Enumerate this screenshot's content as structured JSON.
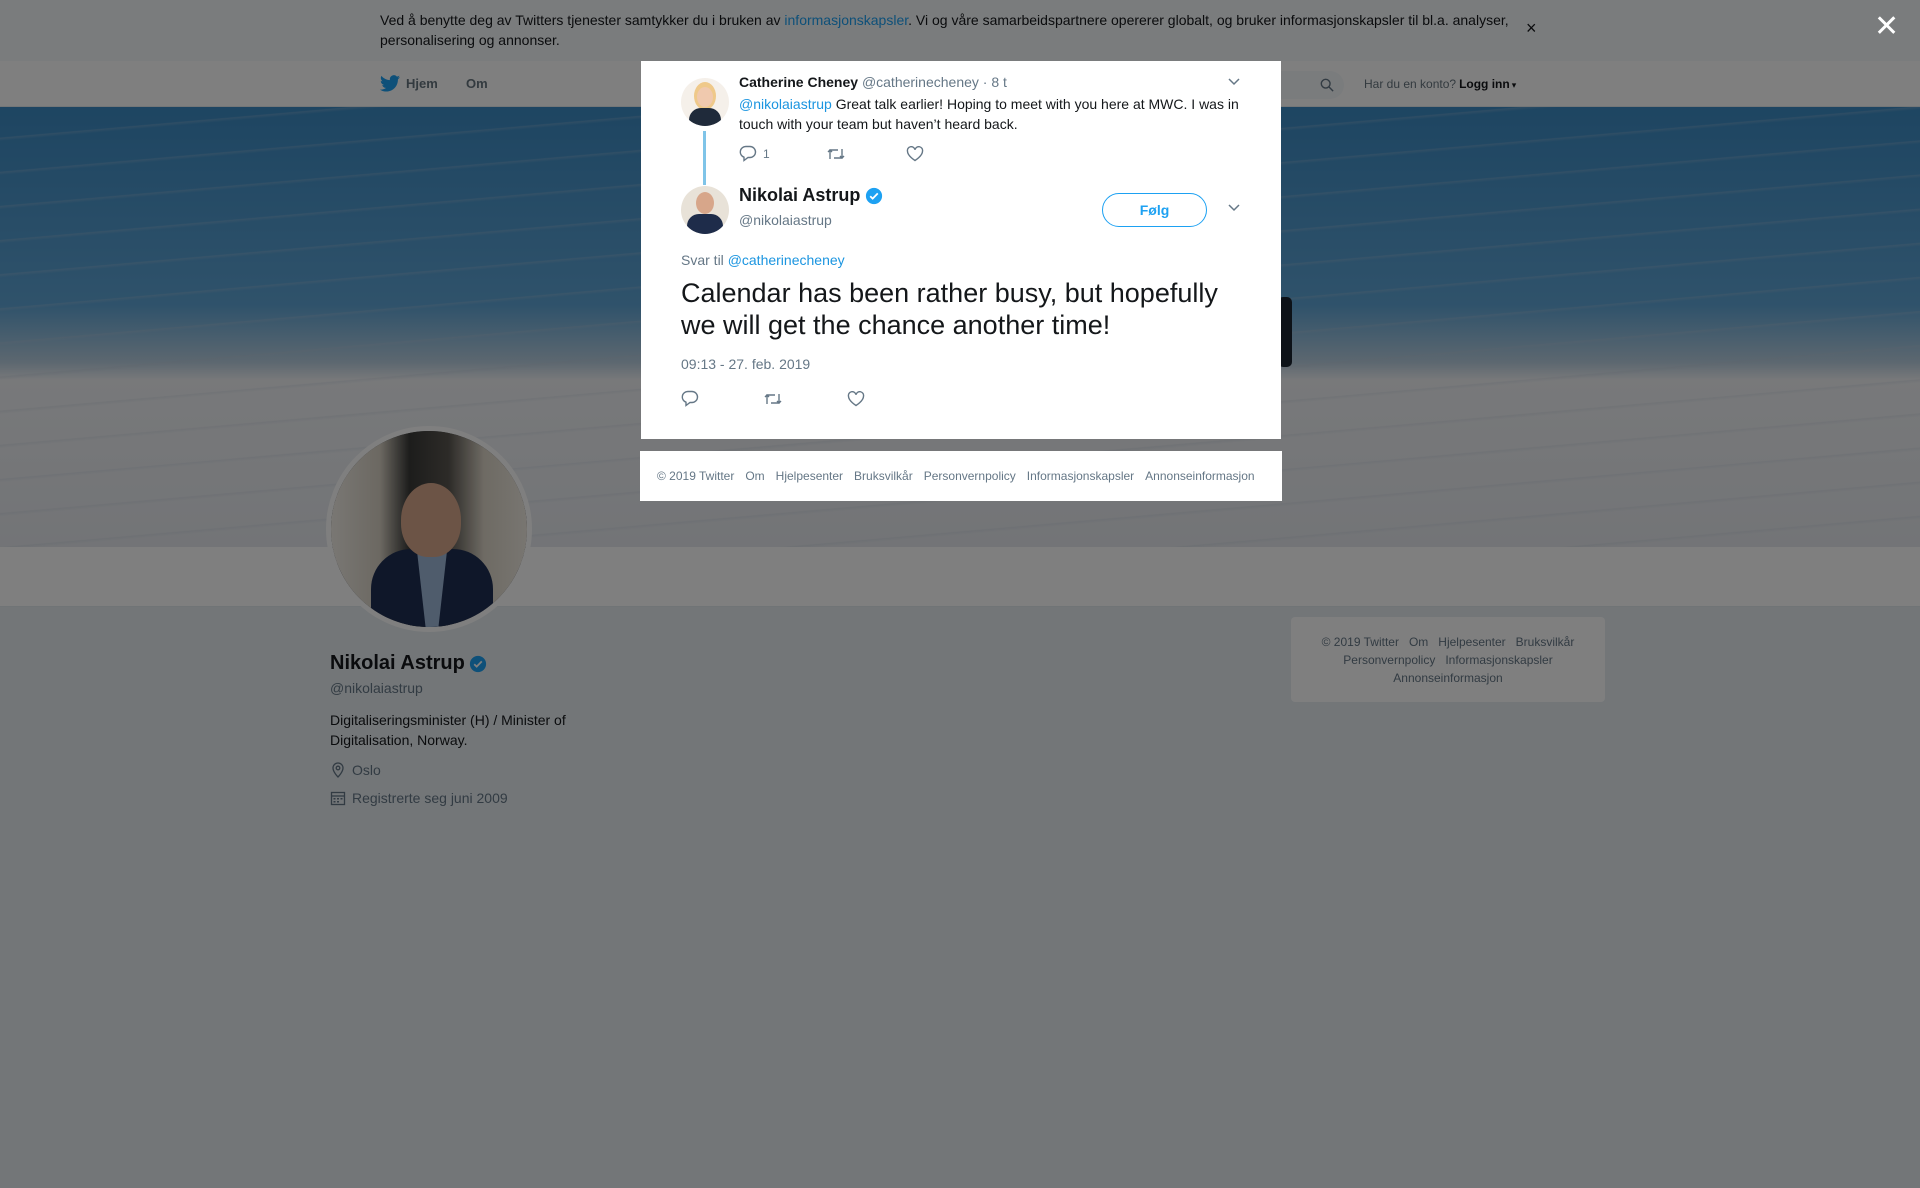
{
  "cookie_banner": {
    "text_before": "Ved å benytte deg av Twitters tjenester samtykker du i bruken av ",
    "link": "informasjonskapsler",
    "text_after": ". Vi og våre samarbeidspartnere opererer globalt, og bruker informasjonskapsler til bl.a. analyser, personalisering og annonser.",
    "close": "×"
  },
  "nav": {
    "home": "Hjem",
    "about": "Om",
    "account_prompt": "Har du en konto?",
    "login": "Logg inn"
  },
  "profile": {
    "name": "Nikolai Astrup",
    "handle": "@nikolaiastrup",
    "bio": "Digitaliseringsminister (H) / Minister of Digitalisation, Norway.",
    "location": "Oslo",
    "joined": "Registrerte seg juni 2009"
  },
  "side_footer": {
    "items": [
      "© 2019 Twitter",
      "Om",
      "Hjelpesenter",
      "Bruksvilkår",
      "Personvernpolicy",
      "Informasjonskapsler",
      "Annonseinformasjon"
    ]
  },
  "overlay": {
    "close": "✕"
  },
  "modal": {
    "parent_tweet": {
      "name": "Catherine Cheney",
      "handle": "@catherinecheney",
      "time": "· 8 t",
      "mention": "@nikolaiastrup",
      "text": " Great talk earlier! Hoping to meet with you here at MWC. I was in touch with your team but haven’t heard back.",
      "reply_count": "1"
    },
    "main_tweet": {
      "name": "Nikolai Astrup",
      "handle": "@nikolaiastrup",
      "follow": "Følg",
      "reply_to_label": "Svar til ",
      "reply_to_mention": "@catherinecheney",
      "text": "Calendar has been rather busy, but hopefully we will get the chance another time!",
      "timestamp": "09:13 - 27. feb. 2019"
    },
    "footer": {
      "items": [
        "© 2019 Twitter",
        "Om",
        "Hjelpesenter",
        "Bruksvilkår",
        "Personvernpolicy",
        "Informasjonskapsler",
        "Annonseinformasjon"
      ]
    }
  },
  "colors": {
    "accent": "#1da1f2",
    "link": "#1b95e0",
    "overlay": "rgba(0,0,0,0.5)"
  }
}
